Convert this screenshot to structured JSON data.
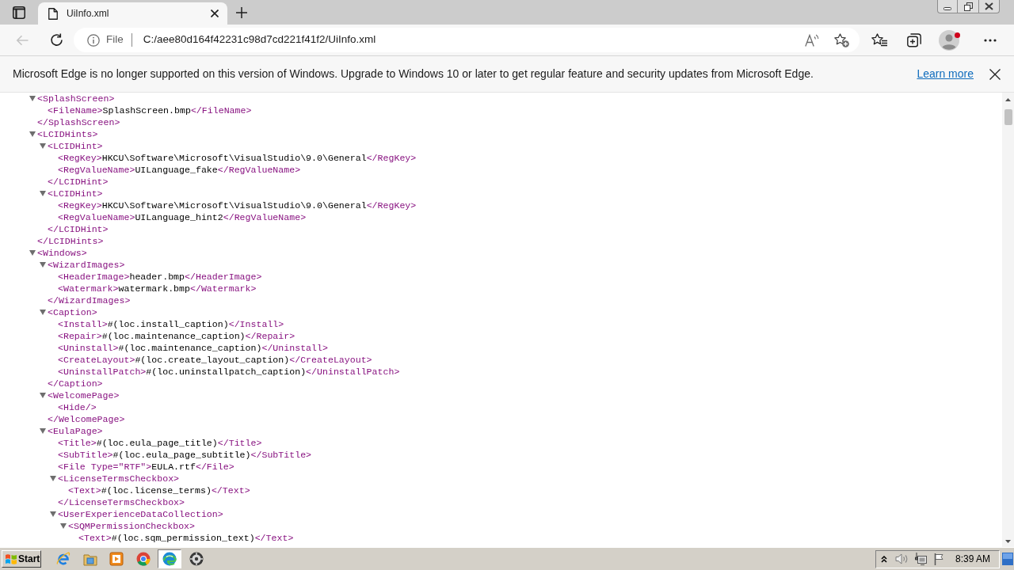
{
  "tab": {
    "title": "UiInfo.xml",
    "selected": true
  },
  "toolbar": {
    "back": {
      "disabled": true
    }
  },
  "address_bar": {
    "scheme": "File",
    "url": "C:/aee80d164f42231c98d7cd221f41f2/UiInfo.xml"
  },
  "infobar": {
    "message": "Microsoft Edge is no longer supported on this version of Windows. Upgrade to Windows 10 or later to get regular feature and security updates from Microsoft Edge.",
    "link": "Learn more"
  },
  "xml_tree": [
    {
      "open": "<SplashScreen>",
      "expanded": true,
      "children": [
        {
          "open": "<FileName>",
          "text": "SplashScreen.bmp",
          "close": "</FileName>"
        }
      ],
      "close": "</SplashScreen>"
    },
    {
      "open": "<LCIDHints>",
      "expanded": true,
      "children": [
        {
          "open": "<LCIDHint>",
          "expanded": true,
          "children": [
            {
              "open": "<RegKey>",
              "text": "HKCU\\Software\\Microsoft\\VisualStudio\\9.0\\General",
              "close": "</RegKey>"
            },
            {
              "open": "<RegValueName>",
              "text": "UILanguage_fake",
              "close": "</RegValueName>"
            }
          ],
          "close": "</LCIDHint>"
        },
        {
          "open": "<LCIDHint>",
          "expanded": true,
          "children": [
            {
              "open": "<RegKey>",
              "text": "HKCU\\Software\\Microsoft\\VisualStudio\\9.0\\General",
              "close": "</RegKey>"
            },
            {
              "open": "<RegValueName>",
              "text": "UILanguage_hint2",
              "close": "</RegValueName>"
            }
          ],
          "close": "</LCIDHint>"
        }
      ],
      "close": "</LCIDHints>"
    },
    {
      "open": "<Windows>",
      "expanded": true,
      "children": [
        {
          "open": "<WizardImages>",
          "expanded": true,
          "children": [
            {
              "open": "<HeaderImage>",
              "text": "header.bmp",
              "close": "</HeaderImage>"
            },
            {
              "open": "<Watermark>",
              "text": "watermark.bmp",
              "close": "</Watermark>"
            }
          ],
          "close": "</WizardImages>"
        },
        {
          "open": "<Caption>",
          "expanded": true,
          "children": [
            {
              "open": "<Install>",
              "text": "#(loc.install_caption)",
              "close": "</Install>"
            },
            {
              "open": "<Repair>",
              "text": "#(loc.maintenance_caption)",
              "close": "</Repair>"
            },
            {
              "open": "<Uninstall>",
              "text": "#(loc.maintenance_caption)",
              "close": "</Uninstall>"
            },
            {
              "open": "<CreateLayout>",
              "text": "#(loc.create_layout_caption)",
              "close": "</CreateLayout>"
            },
            {
              "open": "<UninstallPatch>",
              "text": "#(loc.uninstallpatch_caption)",
              "close": "</UninstallPatch>"
            }
          ],
          "close": "</Caption>"
        },
        {
          "open": "<WelcomePage>",
          "expanded": true,
          "children": [
            {
              "open": "<Hide/>"
            }
          ],
          "close": "</WelcomePage>"
        },
        {
          "open": "<EulaPage>",
          "expanded": true,
          "children": [
            {
              "open": "<Title>",
              "text": "#(loc.eula_page_title)",
              "close": "</Title>"
            },
            {
              "open": "<SubTitle>",
              "text": "#(loc.eula_page_subtitle)",
              "close": "</SubTitle>"
            },
            {
              "open": "<File Type=\"RTF\">",
              "text": "EULA.rtf",
              "close": "</File>"
            },
            {
              "open": "<LicenseTermsCheckbox>",
              "expanded": true,
              "children": [
                {
                  "open": "<Text>",
                  "text": "#(loc.license_terms)",
                  "close": "</Text>"
                }
              ],
              "close": "</LicenseTermsCheckbox>"
            },
            {
              "open": "<UserExperienceDataCollection>",
              "expanded": true,
              "children": [
                {
                  "open": "<SQMPermissionCheckbox>",
                  "expanded": true,
                  "children": [
                    {
                      "open": "<Text>",
                      "text": "#(loc.sqm_permission_text)",
                      "close": "</Text>"
                    }
                  ]
                }
              ]
            }
          ]
        }
      ]
    }
  ],
  "taskbar": {
    "start": "Start",
    "apps": [
      {
        "kind": "e-globe",
        "selected": false
      },
      {
        "kind": "folder",
        "selected": false
      },
      {
        "kind": "player",
        "selected": false
      },
      {
        "kind": "ring",
        "selected": false
      },
      {
        "kind": "wave",
        "selected": true
      },
      {
        "kind": "disc",
        "selected": false
      }
    ],
    "clock": "8:39 AM"
  }
}
